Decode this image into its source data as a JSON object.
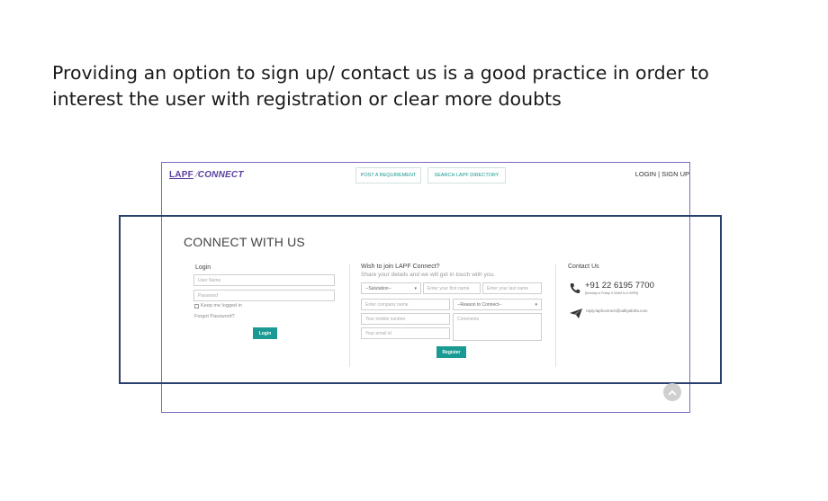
{
  "caption": {
    "line1": "Providing an option to sign up/ contact us  is a good practice in order to",
    "line2": "interest the user with registration or clear more doubts"
  },
  "header": {
    "logo_lapf": "LAPF",
    "logo_connect": "CONNECT",
    "nav": {
      "post": "POST A REQUIREMENT",
      "search": "SEARCH LAPF DIRECTORY"
    },
    "auth": "LOGIN | SIGN UP"
  },
  "section": {
    "title": "CONNECT WITH US"
  },
  "login": {
    "title": "Login",
    "username_placeholder": "User Name",
    "password_placeholder": "Password",
    "keep_logged": "Keep me logged in",
    "forgot": "Forgot Password?",
    "button": "Login"
  },
  "join": {
    "title": "Wish to join LAPF Connect?",
    "subtitle": "Share your details and we will get in touch with you.",
    "salutation": "--Salutation--",
    "first_name_placeholder": "Enter your first name",
    "last_name_placeholder": "Enter your last name",
    "company_placeholder": "Enter company name",
    "reason": "--Reason to Connect--",
    "mobile_placeholder": "Your mobile number",
    "comments_placeholder": "Comments",
    "email_placeholder": "Your email id",
    "button": "Register"
  },
  "contact": {
    "title": "Contact Us",
    "phone": "+91 22 6195 7700",
    "hours": "[Monday to Friday 9.30AM to 6.00PM]",
    "email": "reply.lapfconnect@adityabirla.com"
  },
  "colors": {
    "accent": "#1a9a92",
    "brand": "#5b3fa0",
    "highlight_border": "#2a3f6e",
    "frame_border": "#7c6bbf"
  }
}
